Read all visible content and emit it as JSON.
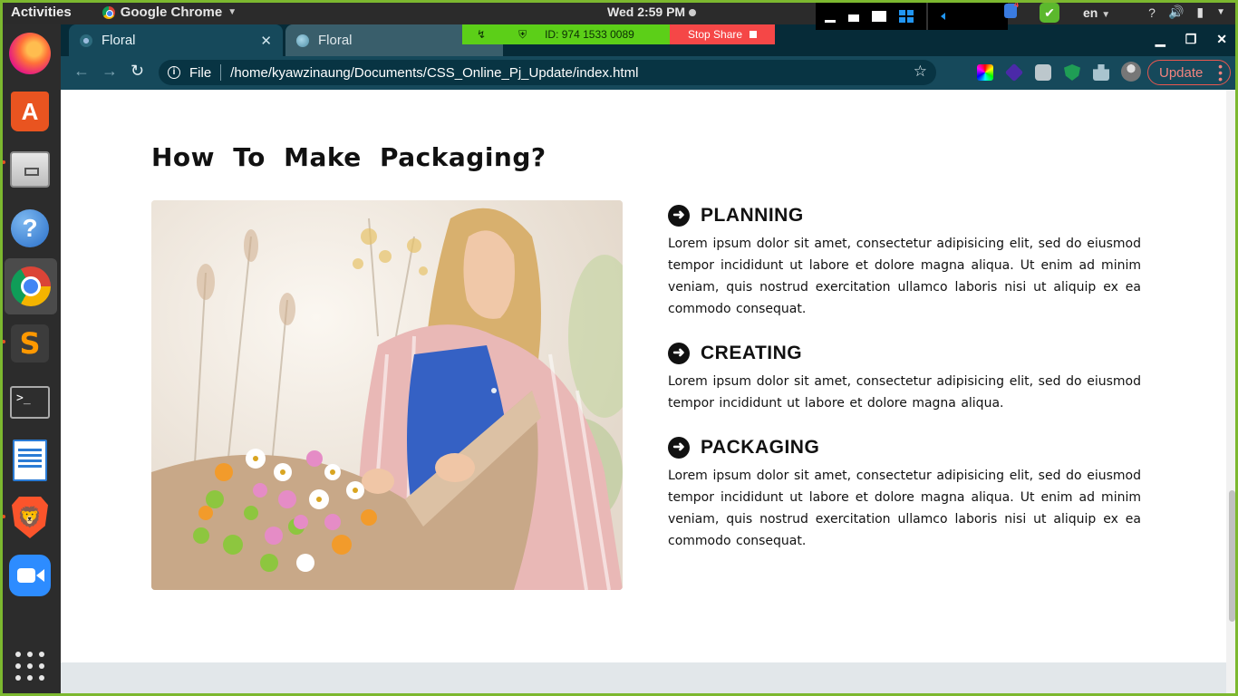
{
  "system": {
    "activities": "Activities",
    "app_name": "Google Chrome",
    "clock": "Wed  2:59 PM",
    "language": "en",
    "help_glyph": "?"
  },
  "dock": {
    "items": [
      "firefox-icon",
      "software-store-icon",
      "files-icon",
      "help-icon",
      "chrome-icon",
      "sublime-text-icon",
      "terminal-icon",
      "writer-icon",
      "brave-icon",
      "zoom-icon",
      "show-apps-icon"
    ],
    "terminal_glyph": ">_",
    "help_glyph": "?",
    "store_glyph": "A",
    "sublime_glyph": "S"
  },
  "share": {
    "id_text": "ID: 974 1533 0089",
    "stop_label": "Stop Share",
    "notification_count": "4"
  },
  "browser": {
    "tabs": [
      {
        "title": "Floral",
        "active": true
      },
      {
        "title": "Floral",
        "active": false
      }
    ],
    "address_scheme": "File",
    "address_path": "/home/kyawzinaung/Documents/CSS_Online_Pj_Update/index.html",
    "update_label": "Update"
  },
  "page": {
    "section_title": "How To Make Packaging?",
    "steps": [
      {
        "title": "PLANNING",
        "body": "Lorem ipsum dolor sit amet, consectetur adipisicing elit, sed do eiusmod tempor incididunt ut labore et dolore magna aliqua. Ut enim ad minim veniam, quis nostrud exercitation ullamco laboris nisi ut aliquip ex ea commodo consequat."
      },
      {
        "title": "CREATING",
        "body": "Lorem ipsum dolor sit amet, consectetur adipisicing elit, sed do eiusmod tempor incididunt ut labore et dolore magna aliqua."
      },
      {
        "title": "PACKAGING",
        "body": "Lorem ipsum dolor sit amet, consectetur adipisicing elit, sed do eiusmod tempor incididunt ut labore et dolore magna aliqua. Ut enim ad minim veniam, quis nostrud exercitation ullamco laboris nisi ut aliquip ex ea commodo consequat."
      }
    ]
  },
  "colors": {
    "chrome_frame": "#062b38",
    "chrome_toolbar": "#16495b",
    "share_green": "#5ccf18",
    "share_red": "#f54747",
    "update_accent": "#e8574f"
  }
}
